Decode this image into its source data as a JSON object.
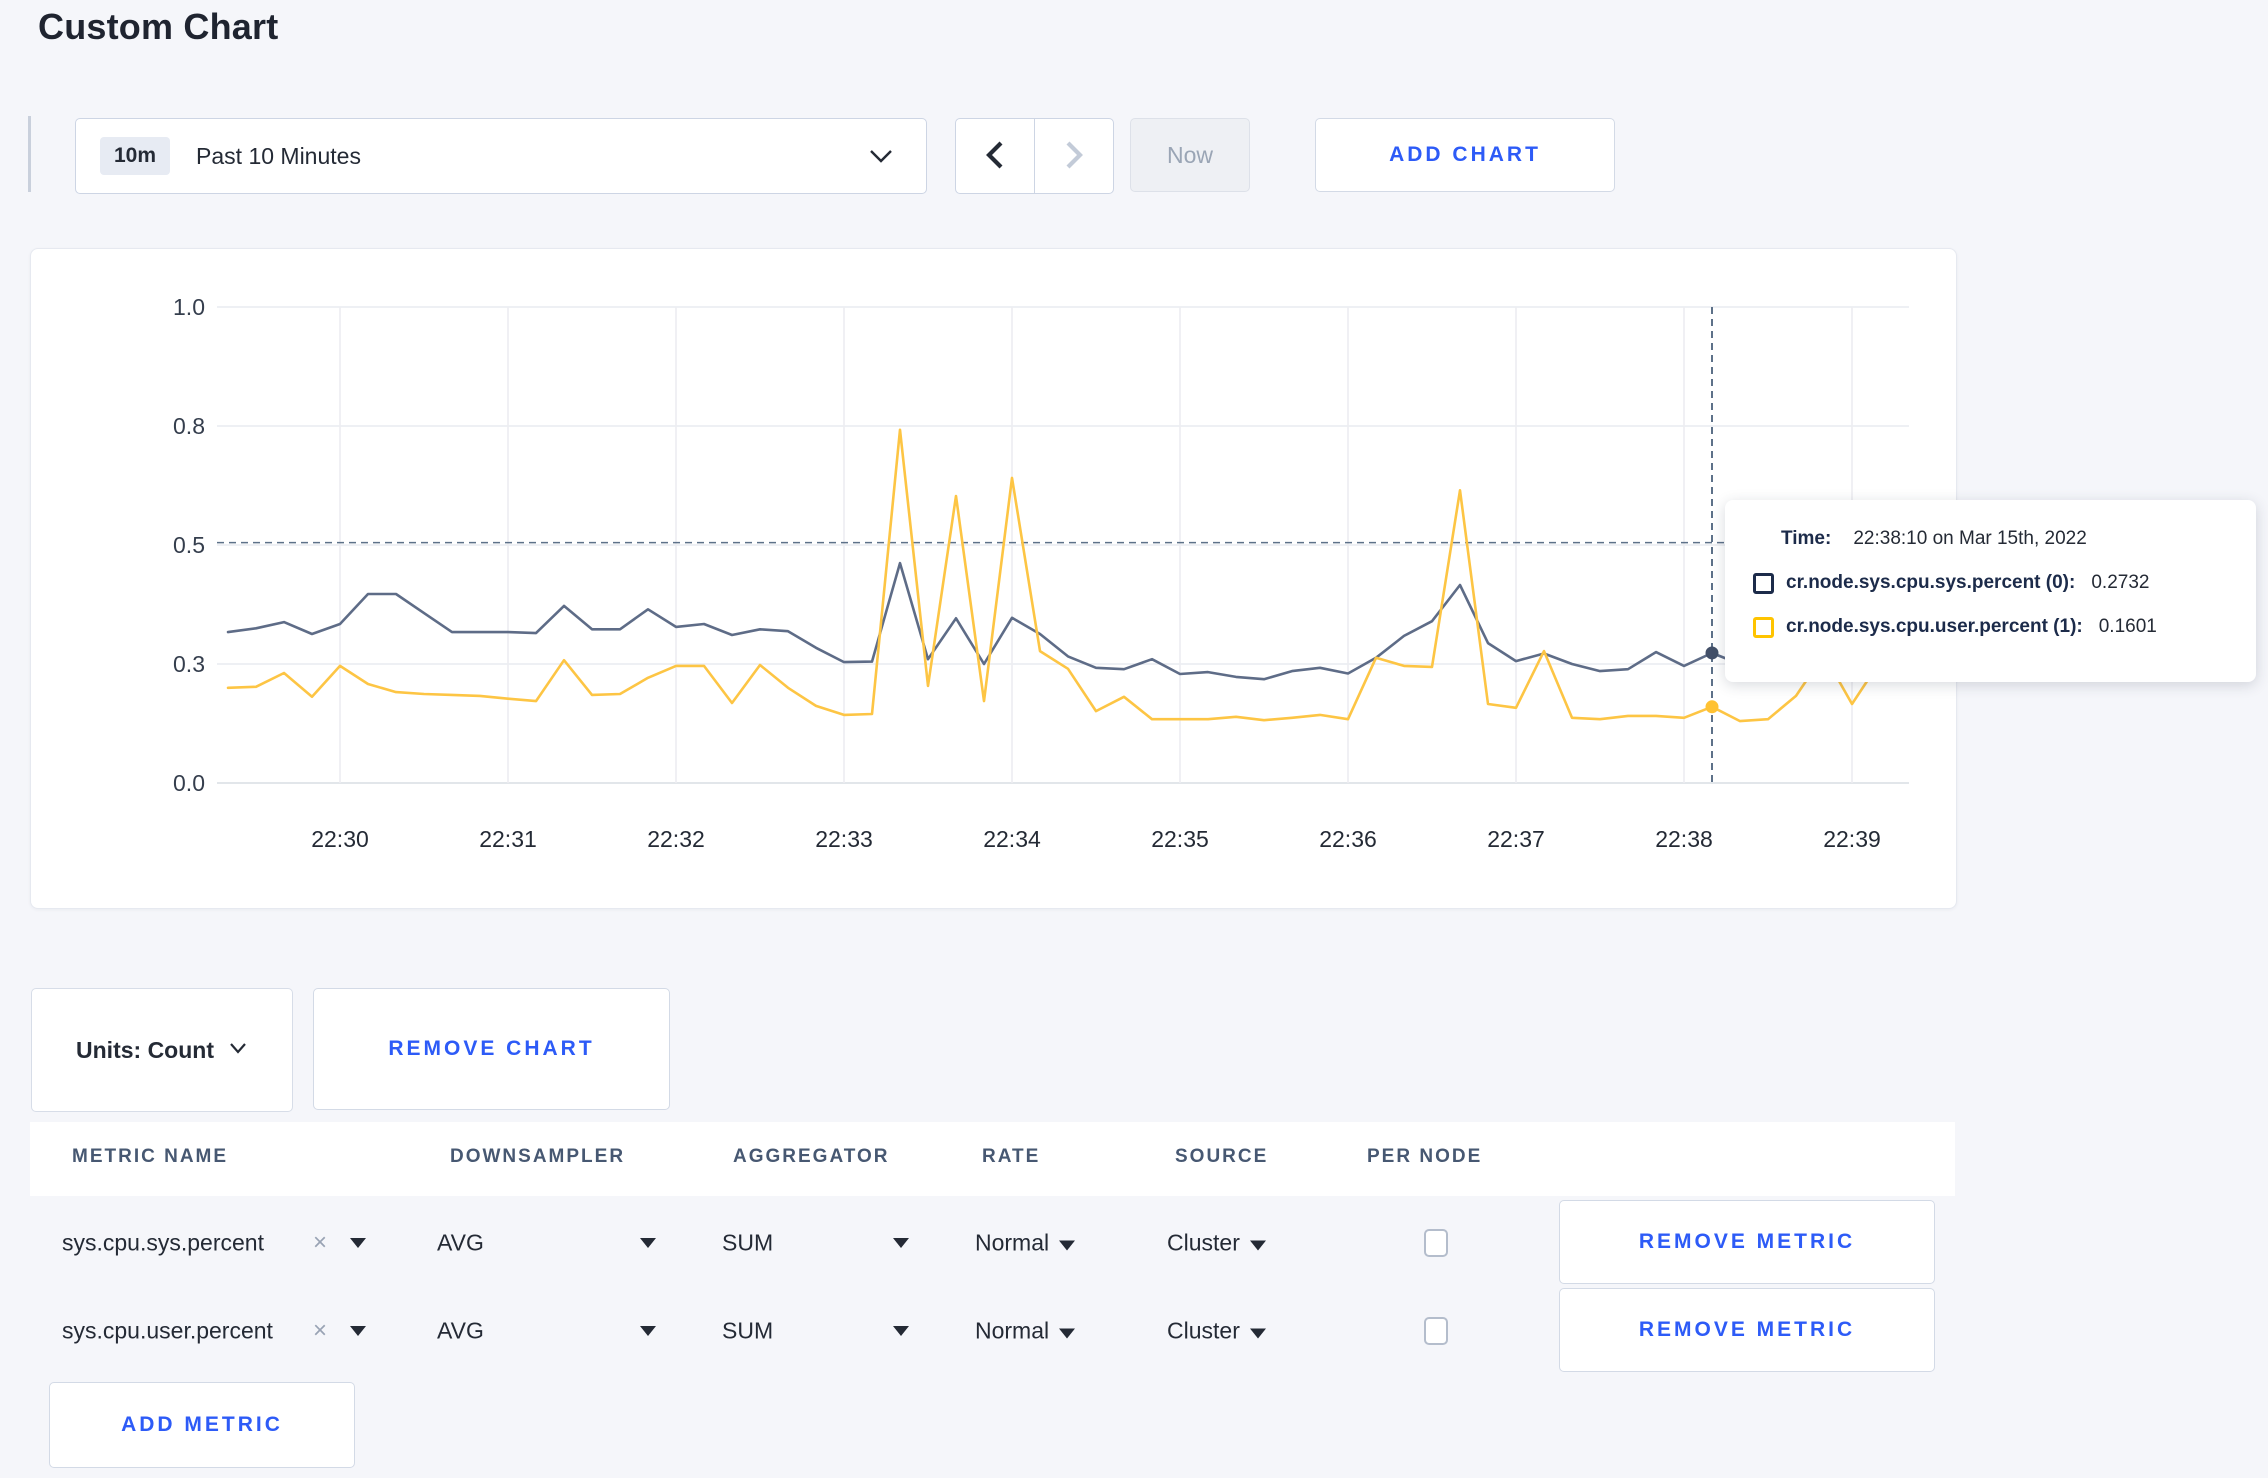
{
  "page": {
    "title": "Custom Chart"
  },
  "toolbar": {
    "range_badge": "10m",
    "range_label": "Past 10 Minutes",
    "now_label": "Now",
    "add_chart_label": "ADD CHART"
  },
  "chart_data": {
    "type": "line",
    "title": "",
    "xlabel": "",
    "ylabel": "",
    "ylim": [
      0,
      1
    ],
    "grid": true,
    "x_start": "22:29:20",
    "x_end": "22:39:20",
    "interval_seconds": 10,
    "y_tick_labels": [
      "1.0",
      "0.8",
      "0.5",
      "0.3",
      "0.0"
    ],
    "y_tick_values": [
      1.0,
      0.75,
      0.5,
      0.25,
      0.0
    ],
    "x_ticks": [
      "22:30",
      "22:31",
      "22:32",
      "22:33",
      "22:34",
      "22:35",
      "22:36",
      "22:37",
      "22:38",
      "22:39"
    ],
    "x_first_tick_index": 4,
    "x_tick_step": 6,
    "series": [
      {
        "name": "cr.node.sys.cpu.sys.percent",
        "color": "#5e6c87",
        "dot_color": "#424f68",
        "values": [
          0.317,
          0.325,
          0.338,
          0.313,
          0.334,
          0.397,
          0.397,
          0.357,
          0.317,
          0.317,
          0.317,
          0.315,
          0.372,
          0.323,
          0.323,
          0.365,
          0.328,
          0.334,
          0.311,
          0.323,
          0.319,
          0.284,
          0.254,
          0.255,
          0.462,
          0.26,
          0.346,
          0.25,
          0.347,
          0.313,
          0.266,
          0.242,
          0.239,
          0.26,
          0.229,
          0.233,
          0.223,
          0.218,
          0.235,
          0.242,
          0.23,
          0.263,
          0.309,
          0.34,
          0.416,
          0.294,
          0.256,
          0.272,
          0.25,
          0.235,
          0.239,
          0.275,
          0.246,
          0.2732,
          0.25,
          0.255,
          0.26,
          0.27,
          0.285,
          0.3,
          0.31
        ]
      },
      {
        "name": "cr.node.sys.cpu.user.percent",
        "color": "#fdc544",
        "dot_color": "#ffc233",
        "values": [
          0.2,
          0.202,
          0.231,
          0.181,
          0.246,
          0.208,
          0.191,
          0.187,
          0.185,
          0.183,
          0.177,
          0.172,
          0.258,
          0.185,
          0.187,
          0.221,
          0.246,
          0.246,
          0.168,
          0.248,
          0.2,
          0.162,
          0.143,
          0.145,
          0.742,
          0.204,
          0.603,
          0.172,
          0.641,
          0.277,
          0.24,
          0.151,
          0.181,
          0.134,
          0.134,
          0.134,
          0.139,
          0.132,
          0.137,
          0.143,
          0.134,
          0.263,
          0.246,
          0.244,
          0.615,
          0.166,
          0.158,
          0.277,
          0.137,
          0.134,
          0.141,
          0.141,
          0.137,
          0.1601,
          0.13,
          0.134,
          0.183,
          0.27,
          0.166,
          0.255,
          0.24
        ]
      }
    ],
    "crosshair": {
      "index": 53,
      "y_value": 0.505
    },
    "legend_position": "tooltip"
  },
  "tooltip": {
    "time_label": "Time:",
    "time_value": "22:38:10 on Mar 15th, 2022",
    "rows": [
      {
        "label": "cr.node.sys.cpu.sys.percent (0):",
        "value": "0.2732",
        "color": "#1c2b4a"
      },
      {
        "label": "cr.node.sys.cpu.user.percent (1):",
        "value": "0.1601",
        "color": "#ffc400"
      }
    ]
  },
  "chart_footer": {
    "units_label": "Units: Count",
    "remove_chart_label": "REMOVE CHART"
  },
  "metrics_table": {
    "headers": [
      "METRIC NAME",
      "DOWNSAMPLER",
      "AGGREGATOR",
      "RATE",
      "SOURCE",
      "PER NODE"
    ],
    "rows": [
      {
        "metric": "sys.cpu.sys.percent",
        "downsampler": "AVG",
        "aggregator": "SUM",
        "rate": "Normal",
        "source": "Cluster",
        "per_node": false
      },
      {
        "metric": "sys.cpu.user.percent",
        "downsampler": "AVG",
        "aggregator": "SUM",
        "rate": "Normal",
        "source": "Cluster",
        "per_node": false
      }
    ],
    "remove_metric_label": "REMOVE METRIC",
    "add_metric_label": "ADD METRIC"
  },
  "colors": {
    "accent_blue": "#2d5bf7",
    "grid": "#e9ebf0",
    "axis_bottom": "#d9dde4",
    "crosshair": "#5d7189",
    "header_text": "#475872"
  }
}
